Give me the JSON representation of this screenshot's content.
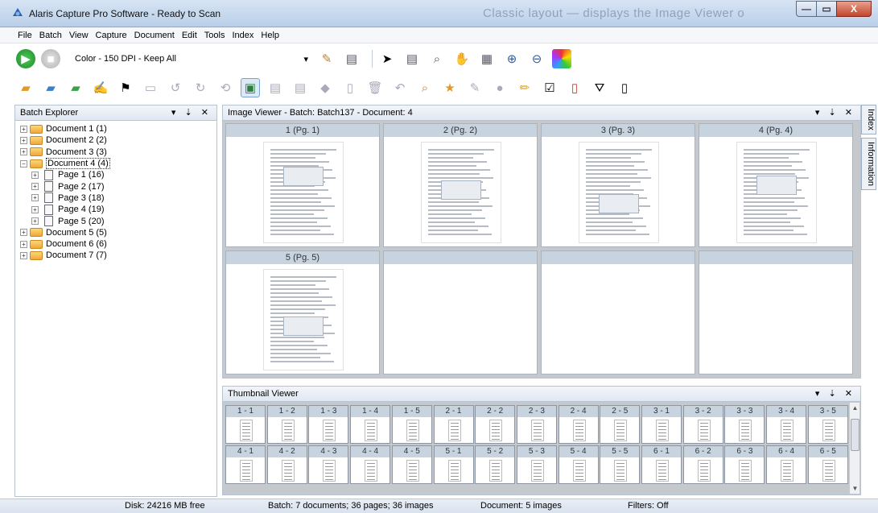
{
  "window": {
    "title": "Alaris Capture Pro Software - Ready to Scan",
    "ghost_text": "Classic layout — displays the Image Viewer o",
    "controls": {
      "minimize": "—",
      "maximize": "▭",
      "close": "X"
    }
  },
  "menu": [
    "File",
    "Batch",
    "View",
    "Capture",
    "Document",
    "Edit",
    "Tools",
    "Index",
    "Help"
  ],
  "toolbar": {
    "profile_value": "Color - 150 DPI - Keep All",
    "dropdown_arrow": "▾"
  },
  "batch_explorer": {
    "title": "Batch Explorer",
    "controls": "▾ ⇣ ✕",
    "items": [
      {
        "label": "Document 1 (1)",
        "type": "doc",
        "expander": "+"
      },
      {
        "label": "Document 2 (2)",
        "type": "doc",
        "expander": "+"
      },
      {
        "label": "Document 3 (3)",
        "type": "doc",
        "expander": "+"
      },
      {
        "label": "Document 4 (4)",
        "type": "doc",
        "expander": "−",
        "selected": true
      },
      {
        "label": "Page 1 (16)",
        "type": "page",
        "expander": "+"
      },
      {
        "label": "Page 2 (17)",
        "type": "page",
        "expander": "+"
      },
      {
        "label": "Page 3 (18)",
        "type": "page",
        "expander": "+"
      },
      {
        "label": "Page 4 (19)",
        "type": "page",
        "expander": "+"
      },
      {
        "label": "Page 5 (20)",
        "type": "page",
        "expander": "+"
      },
      {
        "label": "Document 5 (5)",
        "type": "doc",
        "expander": "+"
      },
      {
        "label": "Document 6 (6)",
        "type": "doc",
        "expander": "+"
      },
      {
        "label": "Document 7 (7)",
        "type": "doc",
        "expander": "+"
      }
    ]
  },
  "image_viewer": {
    "title": "Image Viewer - Batch: Batch137 - Document: 4",
    "controls": "▾ ⇣ ✕",
    "pages": [
      "1 (Pg. 1)",
      "2 (Pg. 2)",
      "3 (Pg. 3)",
      "4 (Pg. 4)",
      "5 (Pg. 5)",
      "",
      "",
      ""
    ]
  },
  "side_tabs": [
    "Index",
    "Information"
  ],
  "thumbnail_viewer": {
    "title": "Thumbnail Viewer",
    "controls": "▾ ⇣ ✕",
    "thumbs": [
      "1 - 1",
      "1 - 2",
      "1 - 3",
      "1 - 4",
      "1 - 5",
      "2 - 1",
      "2 - 2",
      "2 - 3",
      "2 - 4",
      "2 - 5",
      "3 - 1",
      "3 - 2",
      "3 - 3",
      "3 - 4",
      "3 - 5",
      "4 - 1",
      "4 - 2",
      "4 - 3",
      "4 - 4",
      "4 - 5",
      "5 - 1",
      "5 - 2",
      "5 - 3",
      "5 - 4",
      "5 - 5",
      "6 - 1",
      "6 - 2",
      "6 - 3",
      "6 - 4",
      "6 - 5"
    ]
  },
  "status": {
    "disk": "Disk: 24216 MB free",
    "batch": "Batch: 7 documents; 36 pages; 36 images",
    "document": "Document: 5 images",
    "filters": "Filters: Off"
  },
  "colors": {
    "accent": "#c8d3e0",
    "play_green": "#2fa63a",
    "folder_orange": "#f2a73a"
  }
}
